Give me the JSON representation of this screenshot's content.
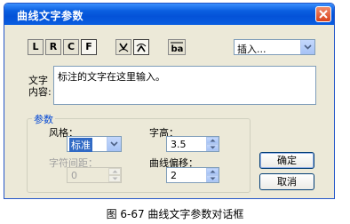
{
  "dialog": {
    "title": "曲线文字参数",
    "close_icon": "close-icon"
  },
  "toolbar": {
    "align_buttons": [
      "L",
      "R",
      "C",
      "F"
    ],
    "pressed": "F",
    "vertical_top_icon": "text-above-curve-icon",
    "vertical_bottom_icon": "text-below-curve-icon",
    "insert_icon": "baseline-text-icon",
    "insert_select": "插入..."
  },
  "content": {
    "label_line1": "文字",
    "label_line2": "内容:",
    "text": "标注的文字在这里输入。"
  },
  "params": {
    "group_title": "参数",
    "style_label": "风格：",
    "style_value": "标准",
    "height_label": "字高：",
    "height_value": "3.5",
    "spacing_label": "字符间距：",
    "spacing_value": "0",
    "offset_label": "曲线偏移：",
    "offset_value": "2"
  },
  "buttons": {
    "ok": "确定",
    "cancel": "取消"
  },
  "caption": "图 6-67  曲线文字参数对话框"
}
